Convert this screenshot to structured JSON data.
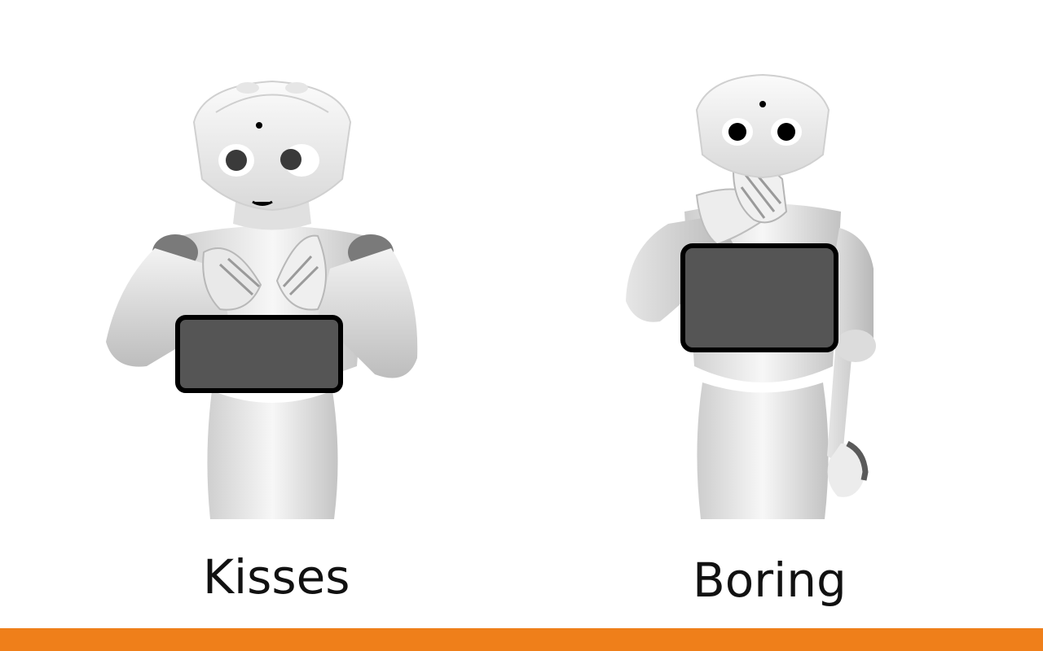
{
  "slide": {
    "accent_color": "#ef7f1a",
    "figures": [
      {
        "caption": "Kisses",
        "icon": "robot-kisses-icon"
      },
      {
        "caption": "Boring",
        "icon": "robot-boring-icon"
      }
    ]
  }
}
